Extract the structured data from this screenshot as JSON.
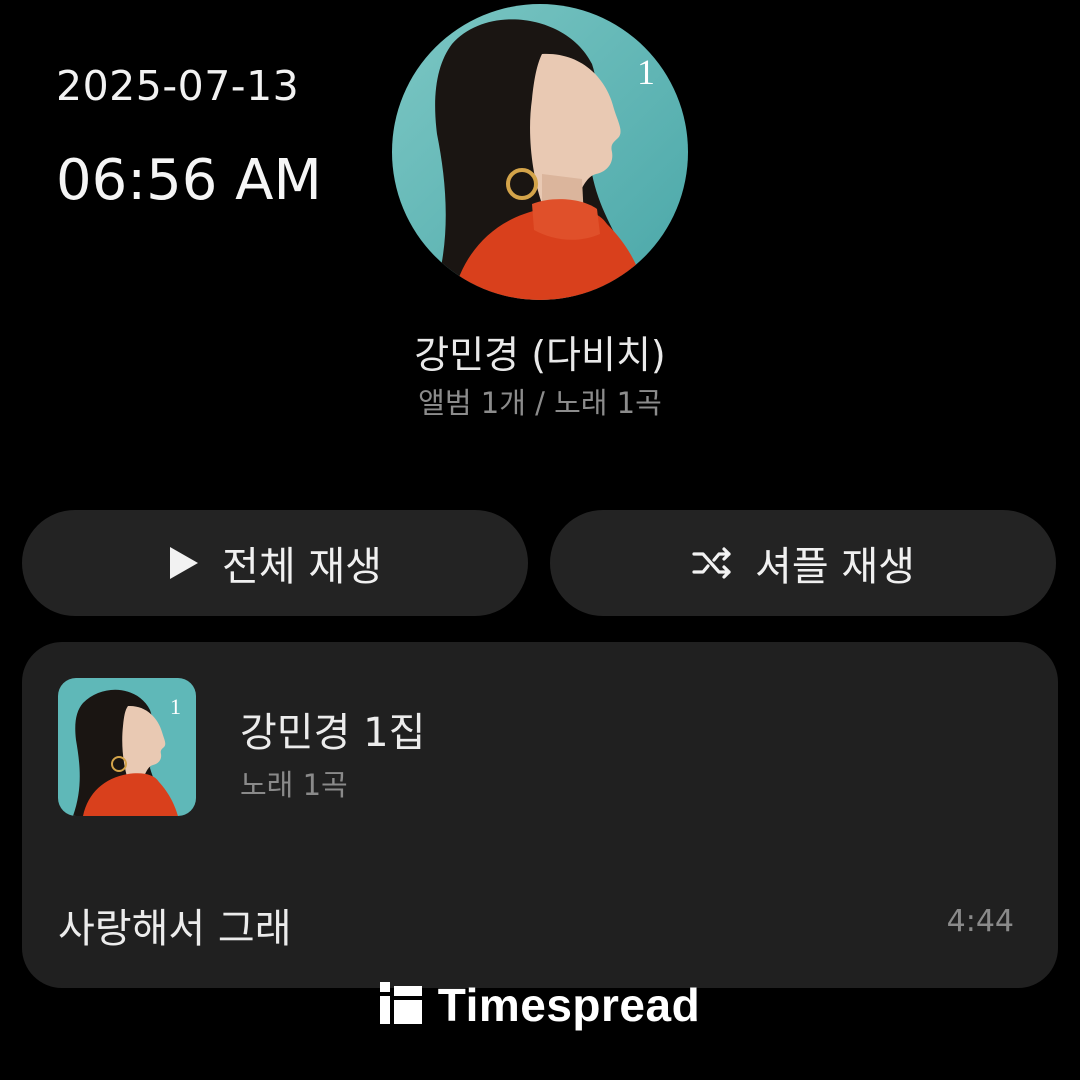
{
  "status": {
    "date": "2025-07-13",
    "time": "06:56 AM"
  },
  "artist": {
    "name": "강민경 (다비치)",
    "meta": "앨범 1개 / 노래 1곡",
    "image": "artist-portrait"
  },
  "actions": {
    "play_all": {
      "label": "전체 재생",
      "icon": "play-icon"
    },
    "shuffle_play": {
      "label": "셔플 재생",
      "icon": "shuffle-icon"
    }
  },
  "album": {
    "title": "강민경 1집",
    "track_count": "노래 1곡",
    "cover_text": "1"
  },
  "tracks": [
    {
      "title": "사랑해서 그래",
      "duration": "4:44"
    }
  ],
  "brand": {
    "name": "Timespread",
    "icon": "timespread-logo-icon"
  },
  "colors": {
    "background": "#000000",
    "surface": "#232323",
    "card": "#202020",
    "cover_teal": "#5fb8b8",
    "cover_red": "#d9401c"
  }
}
